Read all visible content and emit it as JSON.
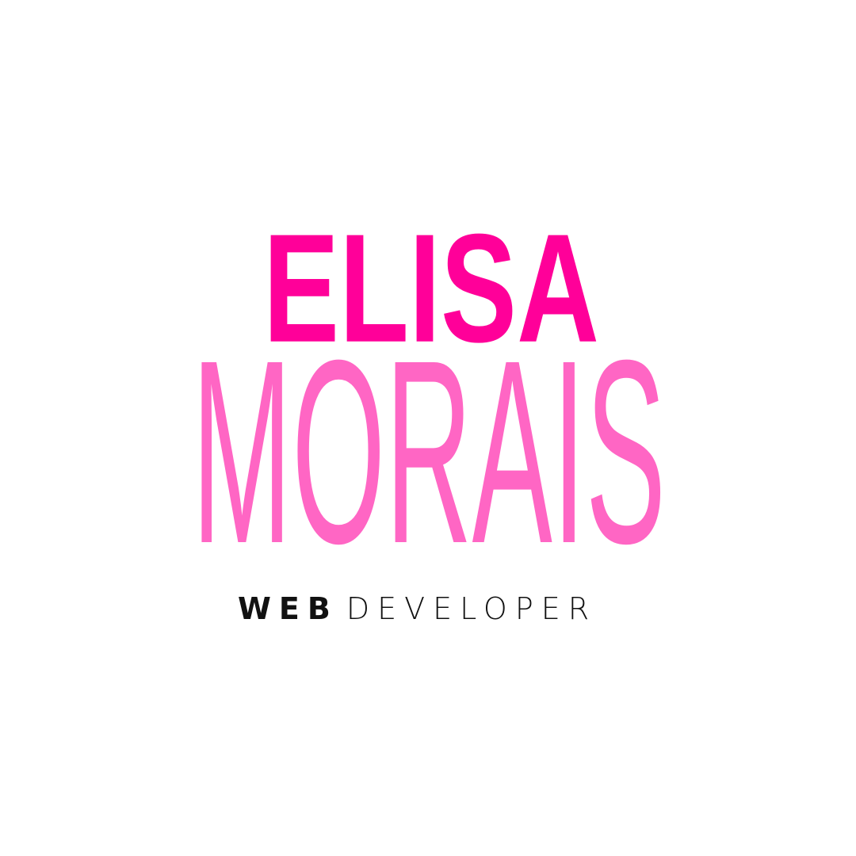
{
  "logo": {
    "first_name": "ELISA",
    "last_name": "MORAIS",
    "tagline_bold": "WEB",
    "tagline_light": "DEVELOPER"
  },
  "colors": {
    "first_name": "#ff0099",
    "last_name": "#ff66c4",
    "tagline": "#111111",
    "background": "#ffffff"
  }
}
